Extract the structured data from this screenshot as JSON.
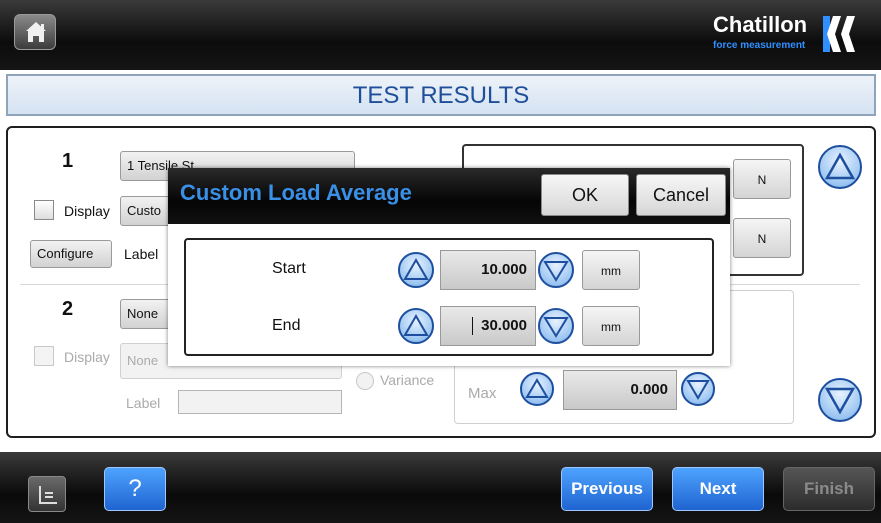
{
  "header": {
    "home_icon": "home-icon",
    "logo": {
      "word": "Chatillon",
      "tagline": "force measurement"
    }
  },
  "title": "TEST RESULTS",
  "result1": {
    "number": "1",
    "test_button": "1  Tensile St",
    "mode_button": "Custo",
    "display_label": "Display",
    "configure_label": "Configure",
    "label_label": "Label",
    "unit_top": "N",
    "unit_bottom": "N"
  },
  "result2": {
    "number": "2",
    "test_button": "None",
    "mode_button": "None",
    "display_label": "Display",
    "label_label": "Label",
    "variance_label": "Variance",
    "max_label": "Max",
    "max_value": "0.000"
  },
  "dialog": {
    "title": "Custom Load Average",
    "ok_label": "OK",
    "cancel_label": "Cancel",
    "rows": [
      {
        "label": "Start",
        "value": "10.000",
        "unit": "mm"
      },
      {
        "label": "End",
        "value": "30.000",
        "unit": "mm"
      }
    ]
  },
  "footer": {
    "menu_icon": "list-icon",
    "help_label": "?",
    "previous_label": "Previous",
    "next_label": "Next",
    "finish_label": "Finish"
  },
  "colors": {
    "accent_blue": "#1f64d0",
    "title_text": "#1f4f9b",
    "dialog_title": "#3a8fe6"
  }
}
